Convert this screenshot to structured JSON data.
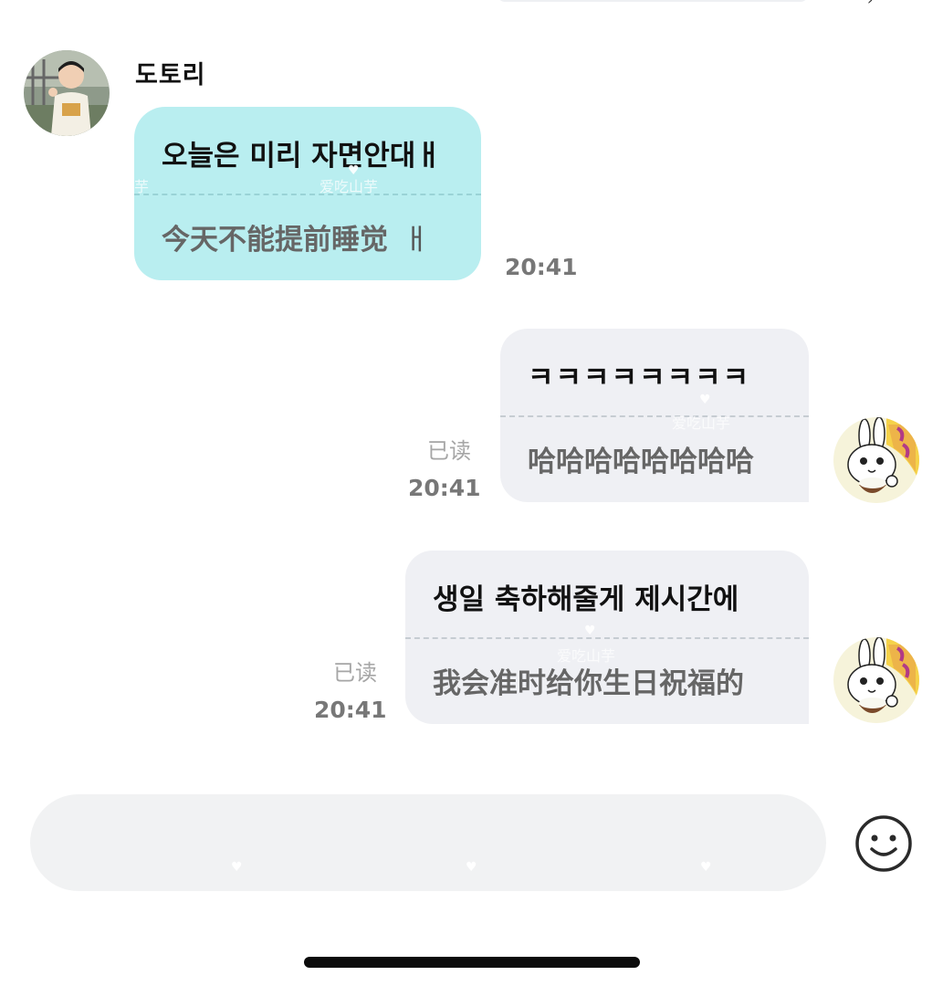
{
  "chat": {
    "contact_name": "도토리",
    "messages": [
      {
        "direction": "incoming",
        "original": "오늘은 미리 자면안대ㅐ",
        "original_text": "오늘은 미리 자면안대",
        "original_tail": "ㅐ",
        "translation_text": "今天不能提前睡觉",
        "translation_tail": "ㅐ",
        "time": "20:41"
      },
      {
        "direction": "outgoing",
        "original_text": "ㅋㅋㅋㅋㅋㅋㅋㅋ",
        "translation_text": "哈哈哈哈哈哈哈哈",
        "read_status": "已读",
        "time": "20:41"
      },
      {
        "direction": "outgoing",
        "original_text": "생일 축하해줄게 제시간에",
        "translation_text": "我会准时给你生日祝福的",
        "read_status": "已读",
        "time": "20:41"
      }
    ]
  },
  "watermark": {
    "text": "爱吃山芋",
    "short_text": "芋",
    "heart": "♥"
  },
  "input": {
    "placeholder": "",
    "emoji_icon": "smiley-face-icon"
  },
  "colors": {
    "incoming_bubble": "#b9eef0",
    "outgoing_bubble": "#eff0f4",
    "input_background": "#f1f2f3",
    "timestamp": "#777777",
    "read_status": "#a6a6a6"
  }
}
